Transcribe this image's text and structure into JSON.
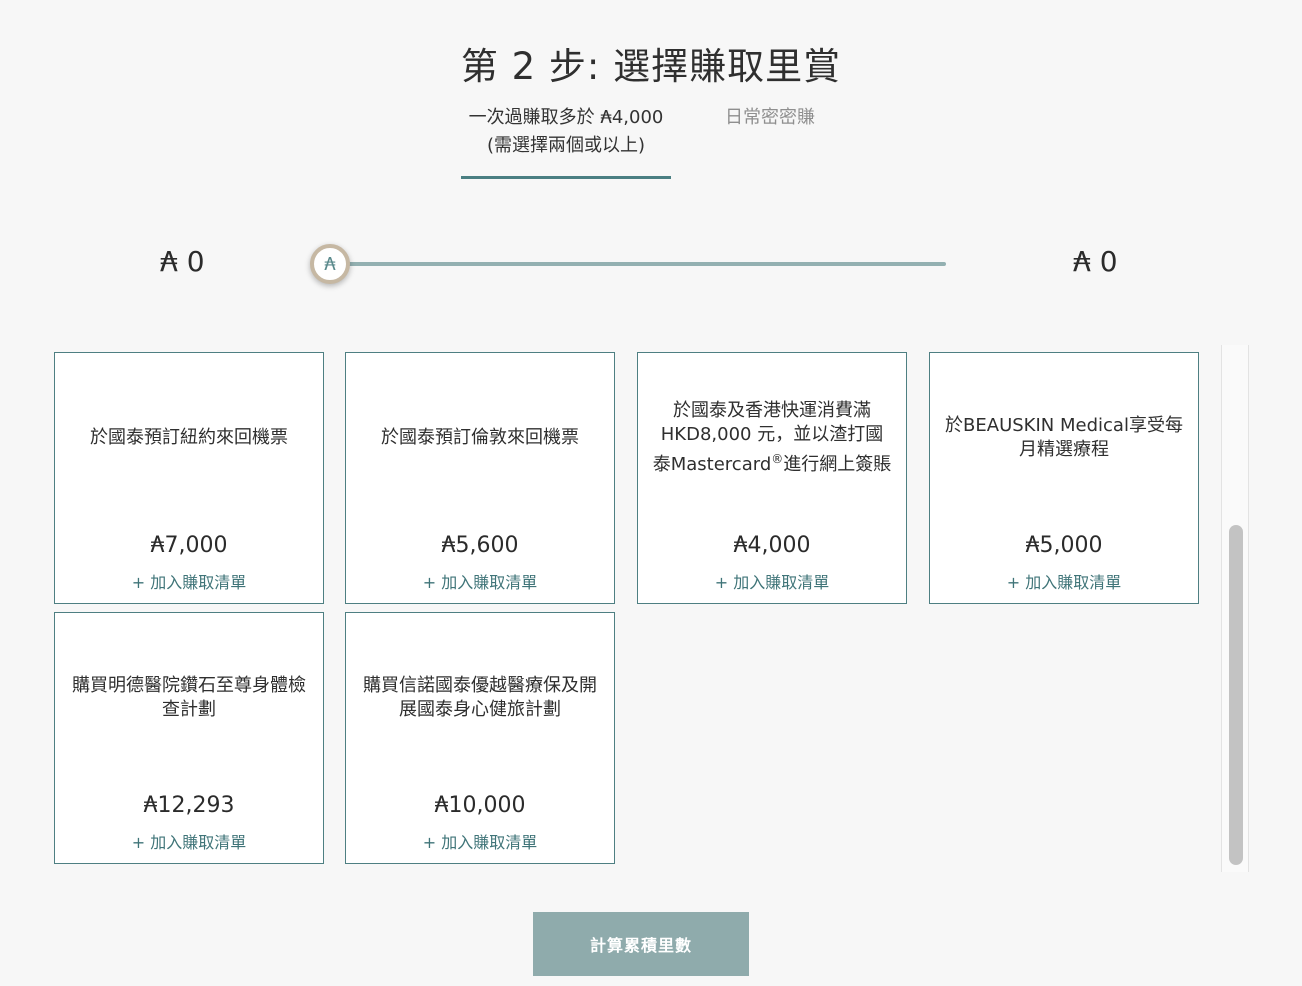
{
  "step": {
    "title": "第 2 步: 選擇賺取里賞"
  },
  "tabs": [
    {
      "label_line1": "一次過賺取多於 ₳4,000",
      "label_line2": "(需選擇兩個或以上)",
      "active": true
    },
    {
      "label_line1": "日常密密賺",
      "active": false
    }
  ],
  "slider": {
    "min_label": "₳ 0",
    "max_label": "₳ 0",
    "handle_symbol": "₳",
    "value_fraction": 0
  },
  "cards": [
    {
      "title": "於國泰預訂紐約來回機票",
      "miles": "₳7,000",
      "add_label": "+ 加入賺取清單"
    },
    {
      "title": "於國泰預訂倫敦來回機票",
      "miles": "₳5,600",
      "add_label": "+ 加入賺取清單"
    },
    {
      "title_html_parts": [
        "於國泰及香港快運消費滿 HKD8,000 元，並以渣打國泰Mastercard",
        "®",
        "進行網上簽賬"
      ],
      "miles": "₳4,000",
      "add_label": "+ 加入賺取清單"
    },
    {
      "title": "於BEAUSKIN Medical享受每月精選療程",
      "miles": "₳5,000",
      "add_label": "+ 加入賺取清單"
    },
    {
      "title": "購買明德醫院鑽石至尊身體檢查計劃",
      "miles": "₳12,293",
      "add_label": "+ 加入賺取清單"
    },
    {
      "title": "購買信諾國泰優越醫療保及開展國泰身心健旅計劃",
      "miles": "₳10,000",
      "add_label": "+ 加入賺取清單"
    }
  ],
  "calculate_button": {
    "label": "計算累積里數"
  },
  "colors": {
    "accent": "#4a7f82",
    "card_border": "#4e7f82",
    "button_bg": "#8fabac",
    "slider_track": "#93b0b1",
    "background": "#f7f7f7"
  }
}
